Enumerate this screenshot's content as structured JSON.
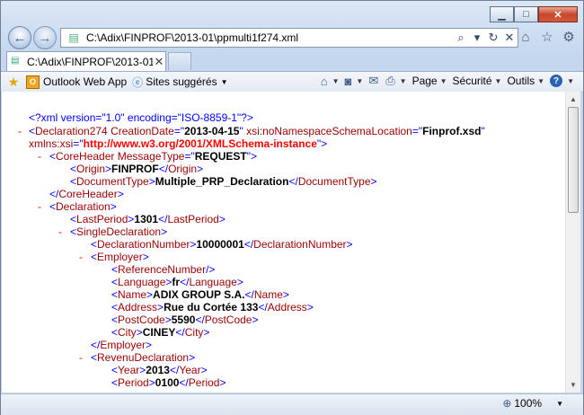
{
  "window": {
    "controls": {
      "minimize": "▁",
      "maximize": "□",
      "close": "✕"
    }
  },
  "nav": {
    "back": "←",
    "forward": "→",
    "address": "C:\\Adix\\FINPROF\\2013-01\\ppmulti1f274.xml",
    "search_icon": "⌕",
    "dropdown_icon": "▾",
    "refresh_icon": "↻",
    "stop_icon": "✕",
    "home_icon": "⌂",
    "favorites_icon": "☆",
    "tools_icon": "⚙"
  },
  "tab": {
    "label": "C:\\Adix\\FINPROF\\2013-01\\...",
    "close": "✕"
  },
  "favbar": {
    "items": [
      {
        "label": "Outlook Web App",
        "icon": "outlook-icon"
      },
      {
        "label": "Sites suggérés",
        "icon": "ie-icon",
        "dropdown": "▼"
      }
    ],
    "commands": [
      {
        "label": "",
        "icon": "home-icon",
        "glyph": "⌂"
      },
      {
        "label": "",
        "icon": "rss-icon",
        "glyph": "◙"
      },
      {
        "label": "",
        "icon": "mail-icon",
        "glyph": "✉"
      },
      {
        "label": "",
        "icon": "print-icon",
        "glyph": "⎙"
      },
      {
        "label": "Page",
        "icon": "",
        "glyph": ""
      },
      {
        "label": "Sécurité",
        "icon": "",
        "glyph": ""
      },
      {
        "label": "Outils",
        "icon": "",
        "glyph": ""
      },
      {
        "label": "",
        "icon": "help-icon",
        "glyph": "?"
      }
    ]
  },
  "xml": {
    "pi": "<?xml version=\"1.0\" encoding=\"ISO-8859-1\"?>",
    "root_tag": "Declaration274",
    "root_attr1_name": "CreationDate",
    "root_attr1_value": "2013-04-15",
    "root_attr2_name": "xsi:noNamespaceSchemaLocation",
    "root_attr2_value": "Finprof.xsd",
    "root_attr3_name": "xmlns:xsi",
    "root_attr3_value": "http://www.w3.org/2001/XMLSchema-instance",
    "coreheader_tag": "CoreHeader",
    "coreheader_attr_name": "MessageType",
    "coreheader_attr_value": "REQUEST",
    "origin_tag": "Origin",
    "origin_value": "FINPROF",
    "doctype_tag": "DocumentType",
    "doctype_value": "Multiple_PRP_Declaration",
    "declaration_tag": "Declaration",
    "lastperiod_tag": "LastPeriod",
    "lastperiod_value": "1301",
    "singledecl_tag": "SingleDeclaration",
    "declnum_tag": "DeclarationNumber",
    "declnum_value": "10000001",
    "employer_tag": "Employer",
    "refnum_tag": "ReferenceNumber",
    "language_tag": "Language",
    "language_value": "fr",
    "name_tag": "Name",
    "name_value": "ADIX GROUP S.A.",
    "address_tag": "Address",
    "address_value": "Rue du Cortée 133",
    "postcode_tag": "PostCode",
    "postcode_value": "5590",
    "city_tag": "City",
    "city_value": "CINEY",
    "revenu_tag": "RevenuDeclaration",
    "year_tag": "Year",
    "year_value": "2013",
    "period_tag": "Period",
    "period_value": "0100",
    "collapse_glyph": "-"
  },
  "status": {
    "zoom": "100%",
    "zoom_dropdown": "▼"
  }
}
